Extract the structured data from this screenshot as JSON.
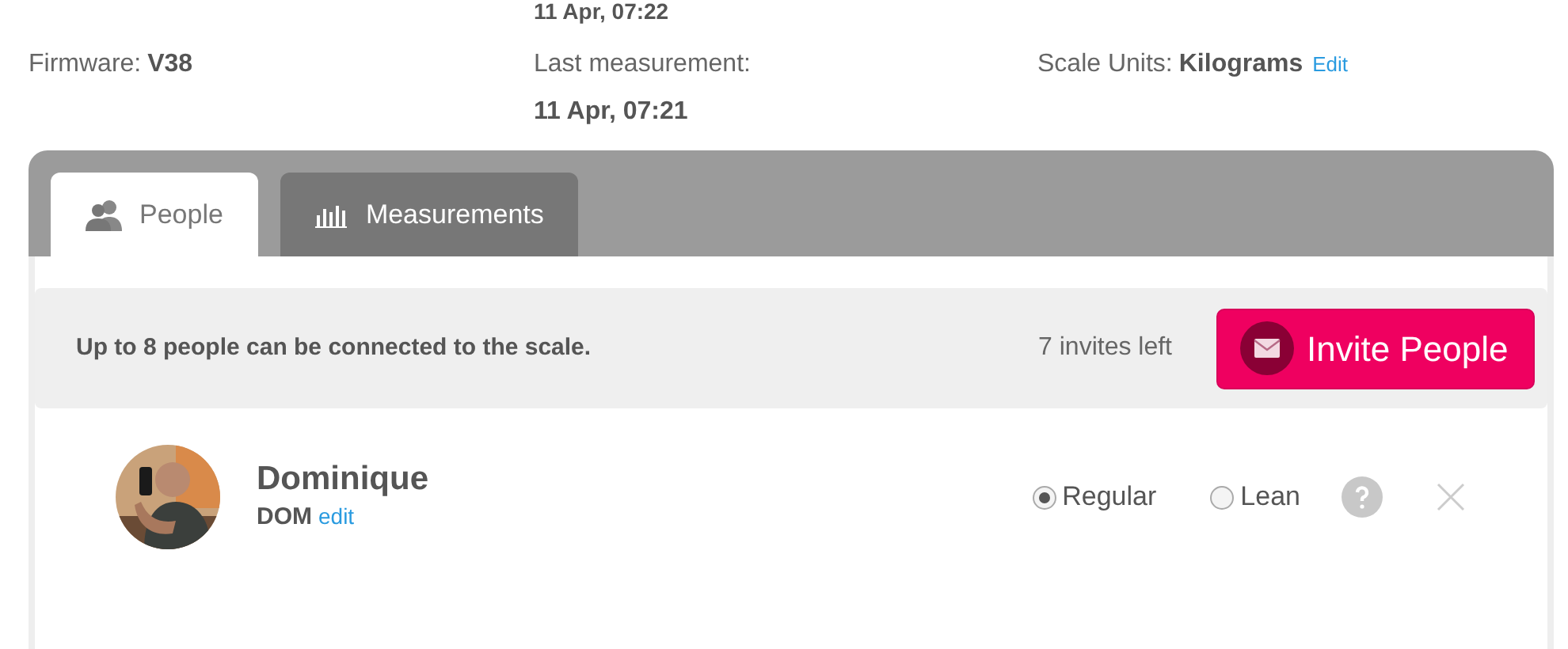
{
  "previous_measurement": "11 Apr, 07:22",
  "info": [
    {
      "label": "Firmware:",
      "value": "V38"
    },
    {
      "label": "Last measurement:",
      "value": "11 Apr, 07:21"
    },
    {
      "label": "Scale Units:",
      "value": "Kilograms",
      "link": "Edit"
    }
  ],
  "tabs": [
    {
      "label": "People",
      "kind": "people",
      "selected": true
    },
    {
      "label": "Measurements",
      "kind": "bars",
      "selected": false
    }
  ],
  "invite_bar": {
    "message": "Up to 8 people can be connected to the scale.",
    "invites_left": "7 invites left",
    "button": "Invite People"
  },
  "people": [
    {
      "name": "Dominique",
      "short_name": "DOM",
      "edit_link": "edit",
      "modes": [
        {
          "label": "Regular",
          "selected": true
        },
        {
          "label": "Lean",
          "selected": false
        }
      ]
    }
  ]
}
